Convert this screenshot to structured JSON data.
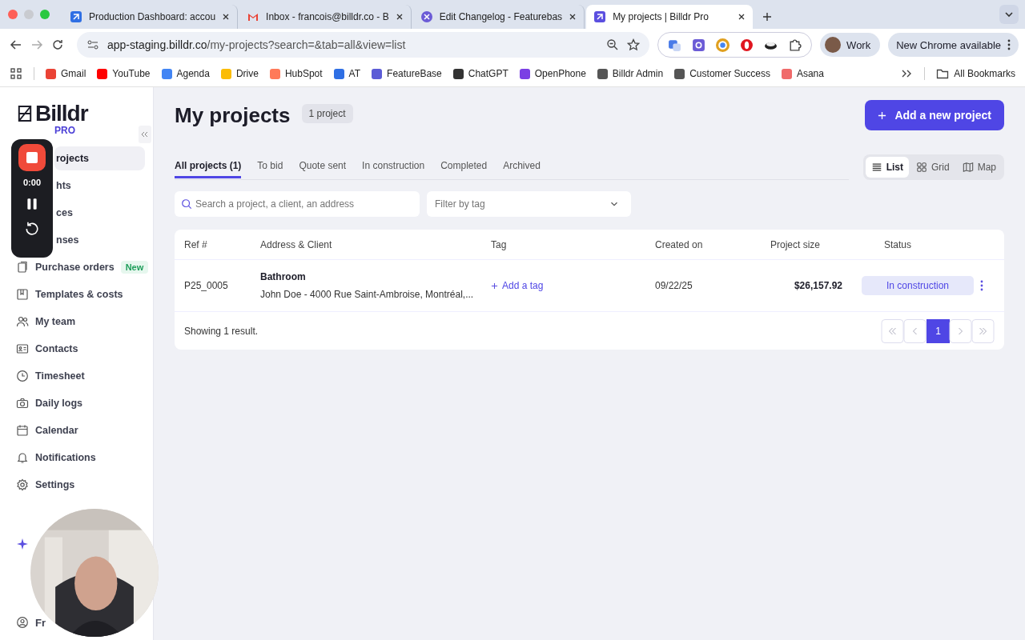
{
  "browser": {
    "tabs": [
      {
        "title": "Production Dashboard: accou",
        "selected": false
      },
      {
        "title": "Inbox - francois@billdr.co - B",
        "selected": false
      },
      {
        "title": "Edit Changelog - Featurebas",
        "selected": false
      },
      {
        "title": "My projects | Billdr Pro",
        "selected": true
      }
    ],
    "url_host": "app-staging.billdr.co",
    "url_path": "/my-projects?search=&tab=all&view=list",
    "profile": "Work",
    "update": "New Chrome available",
    "bookmarks": [
      {
        "label": "Gmail",
        "color": "#ea4335"
      },
      {
        "label": "YouTube",
        "color": "#ff0000"
      },
      {
        "label": "Agenda",
        "color": "#4285f4"
      },
      {
        "label": "Drive",
        "color": "#fbbc04"
      },
      {
        "label": "HubSpot",
        "color": "#ff7a59"
      },
      {
        "label": "AT",
        "color": "#2f6fe4"
      },
      {
        "label": "FeatureBase",
        "color": "#5b5bd6"
      },
      {
        "label": "ChatGPT",
        "color": "#333333"
      },
      {
        "label": "OpenPhone",
        "color": "#7b3fe4"
      },
      {
        "label": "Billdr Admin",
        "color": "#555555"
      },
      {
        "label": "Customer Success",
        "color": "#555555"
      },
      {
        "label": "Asana",
        "color": "#f06a6a"
      }
    ],
    "all_bookmarks": "All Bookmarks"
  },
  "sidebar": {
    "logo": "Billdr",
    "plan": "PRO",
    "items": [
      {
        "label": "rojects",
        "selected": true,
        "covered": true
      },
      {
        "label": "hts",
        "selected": false,
        "covered": true
      },
      {
        "label": "ces",
        "selected": false,
        "covered": true
      },
      {
        "label": "nses",
        "selected": false,
        "covered": true
      },
      {
        "label": "Purchase orders",
        "selected": false,
        "covered": false,
        "badge": "New"
      },
      {
        "label": "Templates & costs",
        "selected": false,
        "covered": false
      },
      {
        "label": "My team",
        "selected": false,
        "covered": false
      },
      {
        "label": "Contacts",
        "selected": false,
        "covered": false
      },
      {
        "label": "Timesheet",
        "selected": false,
        "covered": false
      },
      {
        "label": "Daily logs",
        "selected": false,
        "covered": false
      },
      {
        "label": "Calendar",
        "selected": false,
        "covered": false
      },
      {
        "label": "Notifications",
        "selected": false,
        "covered": false
      },
      {
        "label": "Settings",
        "selected": false,
        "covered": false
      }
    ],
    "footer_user": "Fr"
  },
  "recorder": {
    "time": "0:00"
  },
  "main": {
    "title": "My projects",
    "count": "1 project",
    "add_button": "Add a new project",
    "tabs": [
      {
        "label": "All projects (1)",
        "selected": true
      },
      {
        "label": "To bid",
        "selected": false
      },
      {
        "label": "Quote sent",
        "selected": false
      },
      {
        "label": "In construction",
        "selected": false
      },
      {
        "label": "Completed",
        "selected": false
      },
      {
        "label": "Archived",
        "selected": false
      }
    ],
    "views": [
      {
        "label": "List",
        "selected": true,
        "kind": "list"
      },
      {
        "label": "Grid",
        "selected": false,
        "kind": "grid"
      },
      {
        "label": "Map",
        "selected": false,
        "kind": "map"
      }
    ],
    "search": {
      "placeholder": "Search a project, a client, an address"
    },
    "filter": {
      "placeholder": "Filter by tag"
    },
    "table": {
      "columns": [
        "Ref #",
        "Address & Client",
        "Tag",
        "Created on",
        "Project size",
        "Status"
      ],
      "rows": [
        {
          "ref": "P25_0005",
          "title": "Bathroom",
          "address": "John Doe - 4000 Rue Saint-Ambroise, Montréal,...",
          "tag_action": "Add a tag",
          "created": "09/22/25",
          "size": "$26,157.92",
          "status": "In construction"
        }
      ]
    },
    "showing": "Showing 1 result.",
    "pages": [
      {
        "label": "1",
        "selected": true
      }
    ]
  }
}
